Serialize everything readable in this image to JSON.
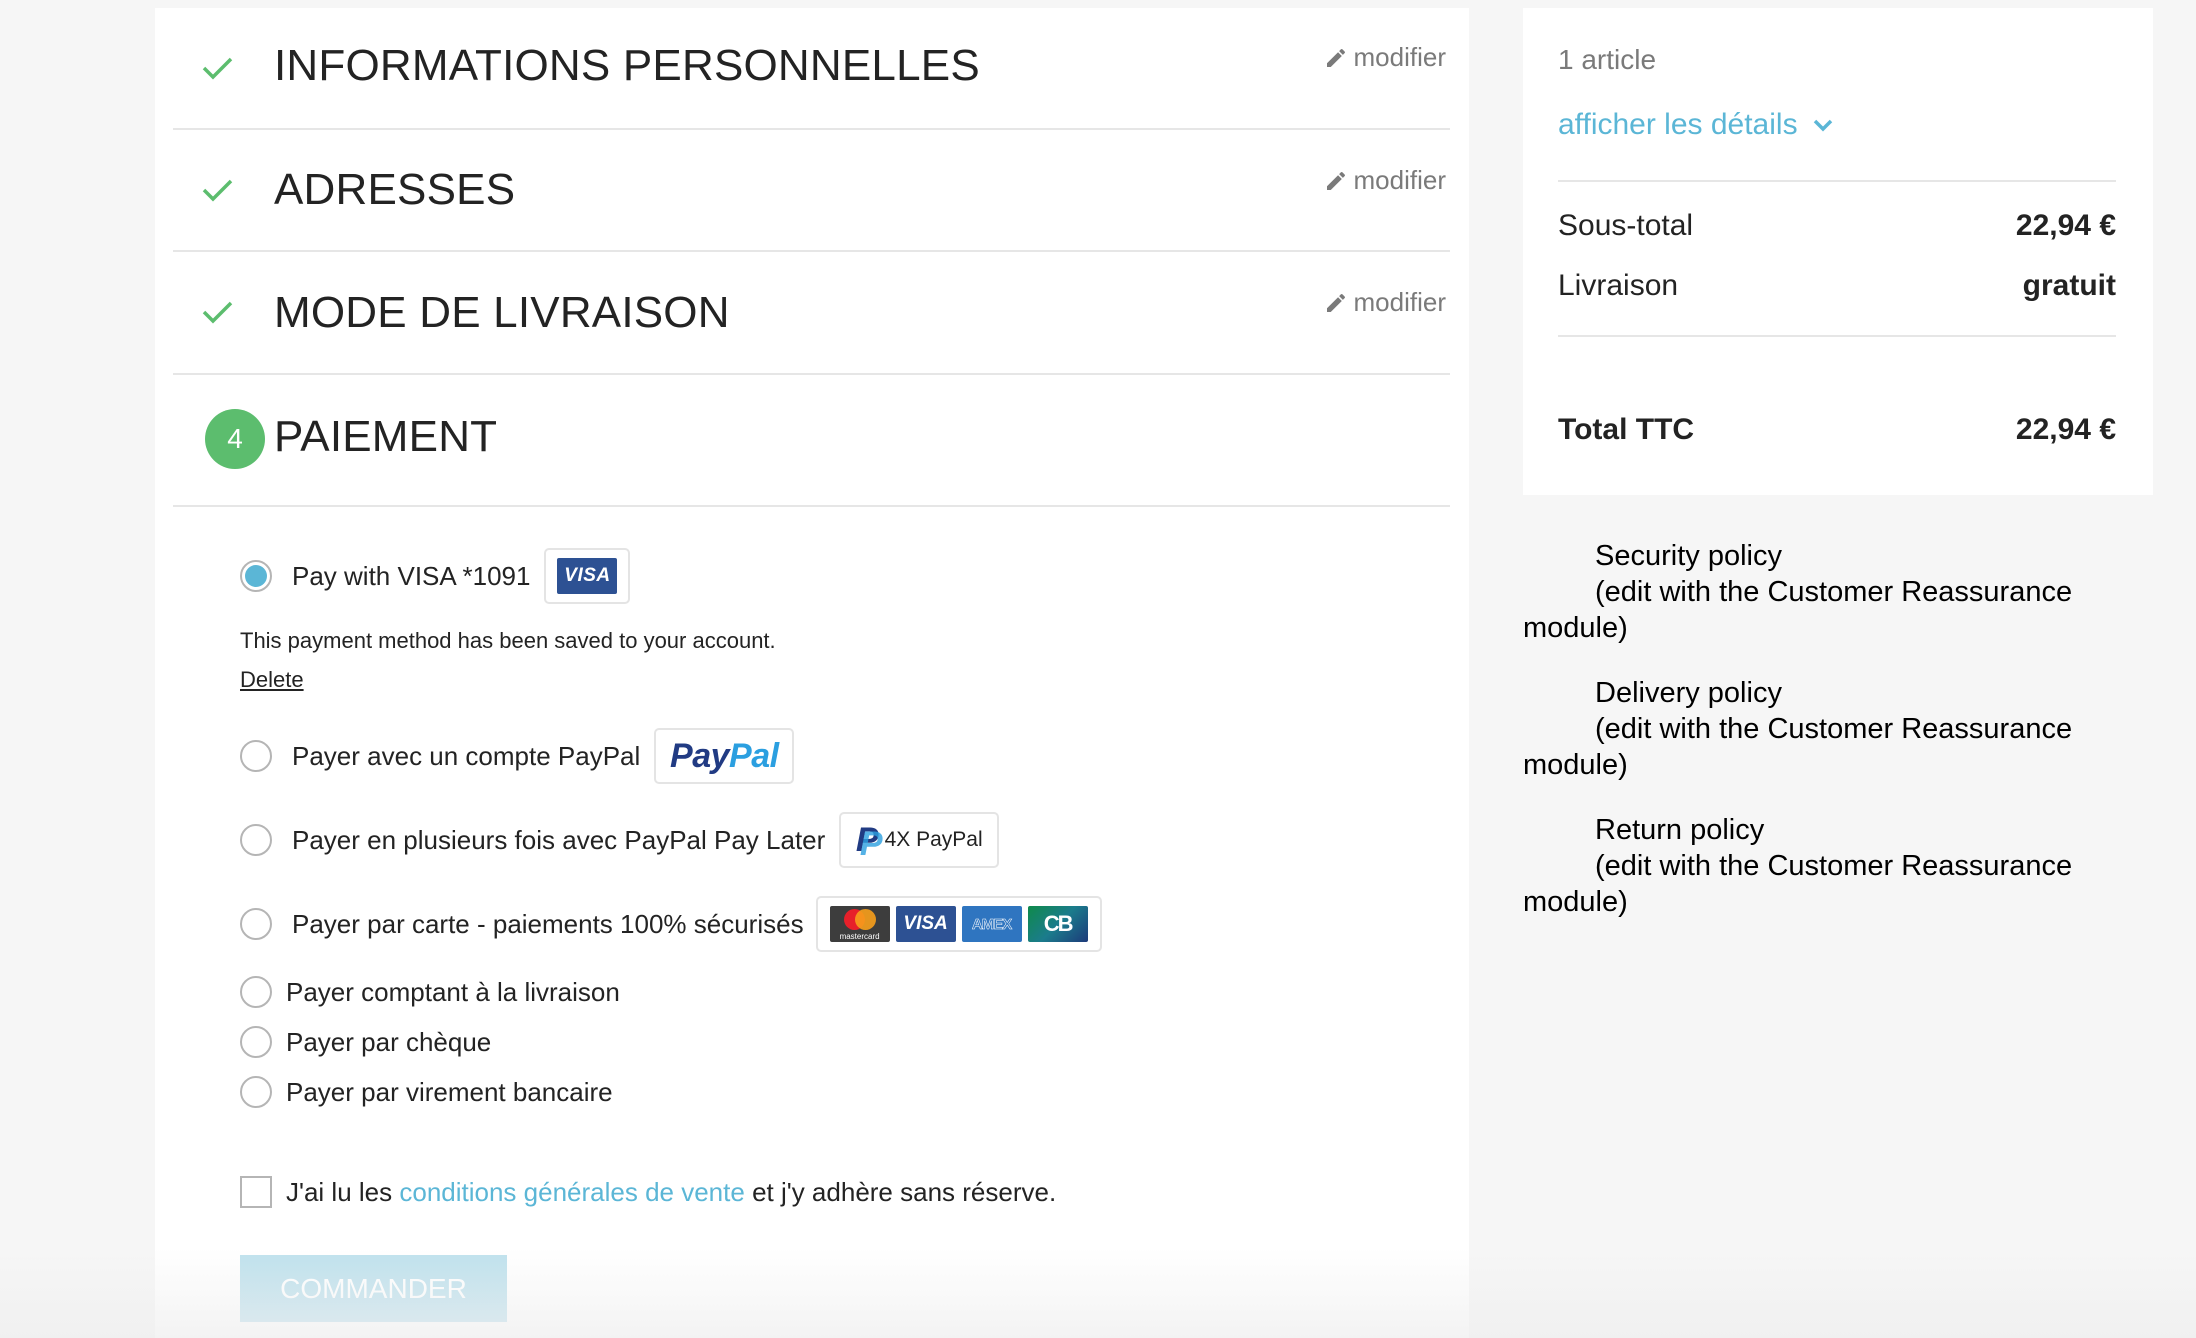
{
  "steps": [
    {
      "title": "Informations personnelles",
      "status": "complete",
      "edit_label": "modifier"
    },
    {
      "title": "Adresses",
      "status": "complete",
      "edit_label": "modifier"
    },
    {
      "title": "Mode de livraison",
      "status": "complete",
      "edit_label": "modifier"
    },
    {
      "title": "Paiement",
      "status": "current",
      "number": "4"
    }
  ],
  "payment": {
    "saved_card": {
      "label": "Pay with VISA *1091",
      "logo": "VISA",
      "selected": true
    },
    "saved_note": "This payment method has been saved to your account.",
    "delete_label": "Delete",
    "options": [
      {
        "label": "Payer avec un compte PayPal",
        "logo": "PayPal",
        "logo_part1": "Pay",
        "logo_part2": "Pal"
      },
      {
        "label": "Payer en plusieurs fois avec PayPal Pay Later",
        "logo": "4X PayPal"
      },
      {
        "label": "Payer par carte - paiements 100% sécurisés",
        "logos": [
          "mastercard",
          "VISA",
          "AMEX",
          "CB"
        ]
      },
      {
        "label": "Payer comptant à la livraison"
      },
      {
        "label": "Payer par chèque"
      },
      {
        "label": "Payer par virement bancaire"
      }
    ]
  },
  "terms": {
    "prefix": "J'ai lu les",
    "link": "conditions générales de vente",
    "suffix": "et j'y adhère sans réserve.",
    "checked": false
  },
  "order_button": "Commander",
  "summary": {
    "count": "1 article",
    "details_link": "afficher les détails",
    "subtotal_label": "Sous-total",
    "subtotal_value": "22,94 €",
    "shipping_label": "Livraison",
    "shipping_value": "gratuit",
    "total_label": "Total TTC",
    "total_value": "22,94 €"
  },
  "reassurance": [
    {
      "title": "Security policy",
      "note1": "(edit with the Customer Reassurance",
      "note2": "module)"
    },
    {
      "title": "Delivery policy",
      "note1": "(edit with the Customer Reassurance",
      "note2": "module)"
    },
    {
      "title": "Return policy",
      "note1": "(edit with the Customer Reassurance",
      "note2": "module)"
    }
  ],
  "colors": {
    "accent": "#5bb6d6",
    "success": "#5cbd6e",
    "button_disabled": "#bee1ed",
    "background": "#f6f6f6"
  }
}
